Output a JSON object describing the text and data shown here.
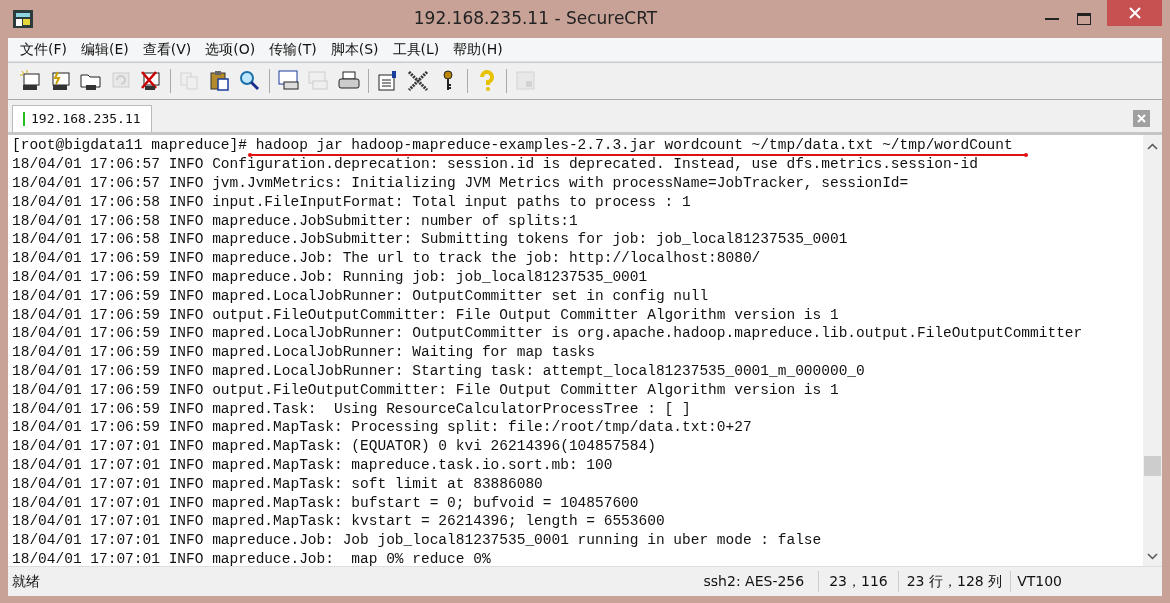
{
  "window": {
    "title": "192.168.235.11 - SecureCRT"
  },
  "menu": [
    "文件(F)",
    "编辑(E)",
    "查看(V)",
    "选项(O)",
    "传输(T)",
    "脚本(S)",
    "工具(L)",
    "帮助(H)"
  ],
  "toolbar": [
    [
      {
        "kind": "new-session",
        "disabled": false
      },
      {
        "kind": "quick-connect",
        "disabled": false
      },
      {
        "kind": "connect-tab",
        "disabled": false
      },
      {
        "kind": "reconnect",
        "disabled": true
      },
      {
        "kind": "disconnect",
        "disabled": false
      }
    ],
    [
      {
        "kind": "copy",
        "disabled": true
      },
      {
        "kind": "paste",
        "disabled": false
      },
      {
        "kind": "find",
        "disabled": false
      }
    ],
    [
      {
        "kind": "print-setup",
        "disabled": false
      },
      {
        "kind": "print-selection",
        "disabled": true
      },
      {
        "kind": "print",
        "disabled": false
      }
    ],
    [
      {
        "kind": "session-options",
        "disabled": false
      },
      {
        "kind": "keymap",
        "disabled": false
      },
      {
        "kind": "key",
        "disabled": false
      }
    ],
    [
      {
        "kind": "help",
        "disabled": false
      }
    ],
    [
      {
        "kind": "sftp",
        "disabled": true
      }
    ]
  ],
  "tabs": [
    {
      "label": "192.168.235.11",
      "selected": true
    }
  ],
  "terminal": {
    "lines": [
      "[root@bigdata11 mapreduce]# hadoop jar hadoop-mapreduce-examples-2.7.3.jar wordcount ~/tmp/data.txt ~/tmp/wordCount",
      "18/04/01 17:06:57 INFO Configuration.deprecation: session.id is deprecated. Instead, use dfs.metrics.session-id",
      "18/04/01 17:06:57 INFO jvm.JvmMetrics: Initializing JVM Metrics with processName=JobTracker, sessionId=",
      "18/04/01 17:06:58 INFO input.FileInputFormat: Total input paths to process : 1",
      "18/04/01 17:06:58 INFO mapreduce.JobSubmitter: number of splits:1",
      "18/04/01 17:06:58 INFO mapreduce.JobSubmitter: Submitting tokens for job: job_local81237535_0001",
      "18/04/01 17:06:59 INFO mapreduce.Job: The url to track the job: http://localhost:8080/",
      "18/04/01 17:06:59 INFO mapreduce.Job: Running job: job_local81237535_0001",
      "18/04/01 17:06:59 INFO mapred.LocalJobRunner: OutputCommitter set in config null",
      "18/04/01 17:06:59 INFO output.FileOutputCommitter: File Output Committer Algorithm version is 1",
      "18/04/01 17:06:59 INFO mapred.LocalJobRunner: OutputCommitter is org.apache.hadoop.mapreduce.lib.output.FileOutputCommitter",
      "18/04/01 17:06:59 INFO mapred.LocalJobRunner: Waiting for map tasks",
      "18/04/01 17:06:59 INFO mapred.LocalJobRunner: Starting task: attempt_local81237535_0001_m_000000_0",
      "18/04/01 17:06:59 INFO output.FileOutputCommitter: File Output Committer Algorithm version is 1",
      "18/04/01 17:06:59 INFO mapred.Task:  Using ResourceCalculatorProcessTree : [ ]",
      "18/04/01 17:06:59 INFO mapred.MapTask: Processing split: file:/root/tmp/data.txt:0+27",
      "18/04/01 17:07:01 INFO mapred.MapTask: (EQUATOR) 0 kvi 26214396(104857584)",
      "18/04/01 17:07:01 INFO mapred.MapTask: mapreduce.task.io.sort.mb: 100",
      "18/04/01 17:07:01 INFO mapred.MapTask: soft limit at 83886080",
      "18/04/01 17:07:01 INFO mapred.MapTask: bufstart = 0; bufvoid = 104857600",
      "18/04/01 17:07:01 INFO mapred.MapTask: kvstart = 26214396; length = 6553600",
      "18/04/01 17:07:01 INFO mapreduce.Job: Job job_local81237535_0001 running in uber mode : false",
      "18/04/01 17:07:01 INFO mapreduce.Job:  map 0% reduce 0%"
    ]
  },
  "status_bar": {
    "message": "就绪",
    "encryption": "ssh2: AES-256",
    "cursor": "23，116",
    "size": "23 行，128 列",
    "terminal_type": "VT100"
  }
}
